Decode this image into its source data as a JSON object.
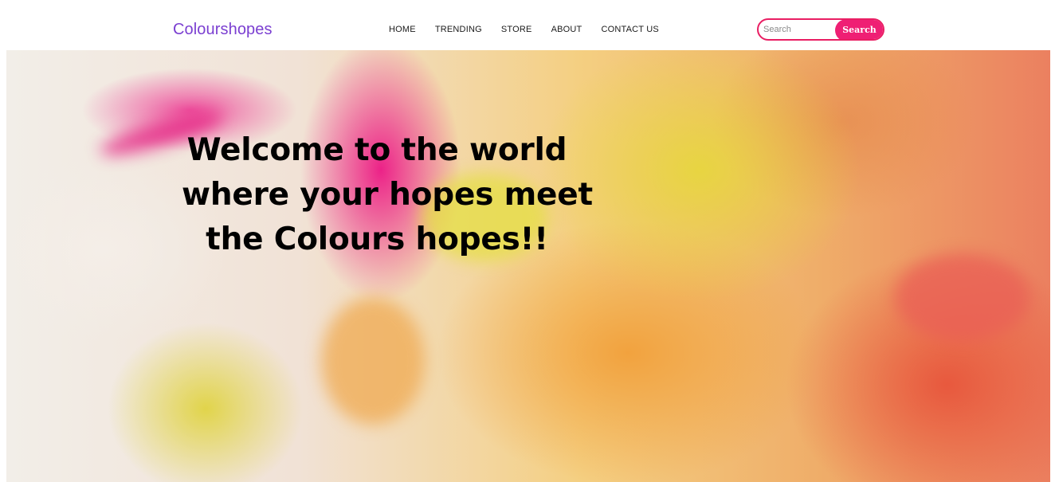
{
  "header": {
    "brand": "Colourshopes",
    "nav": [
      {
        "label": "HOME"
      },
      {
        "label": "TRENDING"
      },
      {
        "label": "STORE"
      },
      {
        "label": "ABOUT"
      },
      {
        "label": "CONTACT US"
      }
    ],
    "search": {
      "placeholder": "Search",
      "button_label": "Search"
    }
  },
  "hero": {
    "headline_lines": [
      "Welcome to the world",
      "where your hopes meet",
      "the Colours hopes!!"
    ]
  },
  "colors": {
    "brand": "#7b3fd1",
    "accent": "#ef1f74",
    "text": "#1a1a1a"
  }
}
